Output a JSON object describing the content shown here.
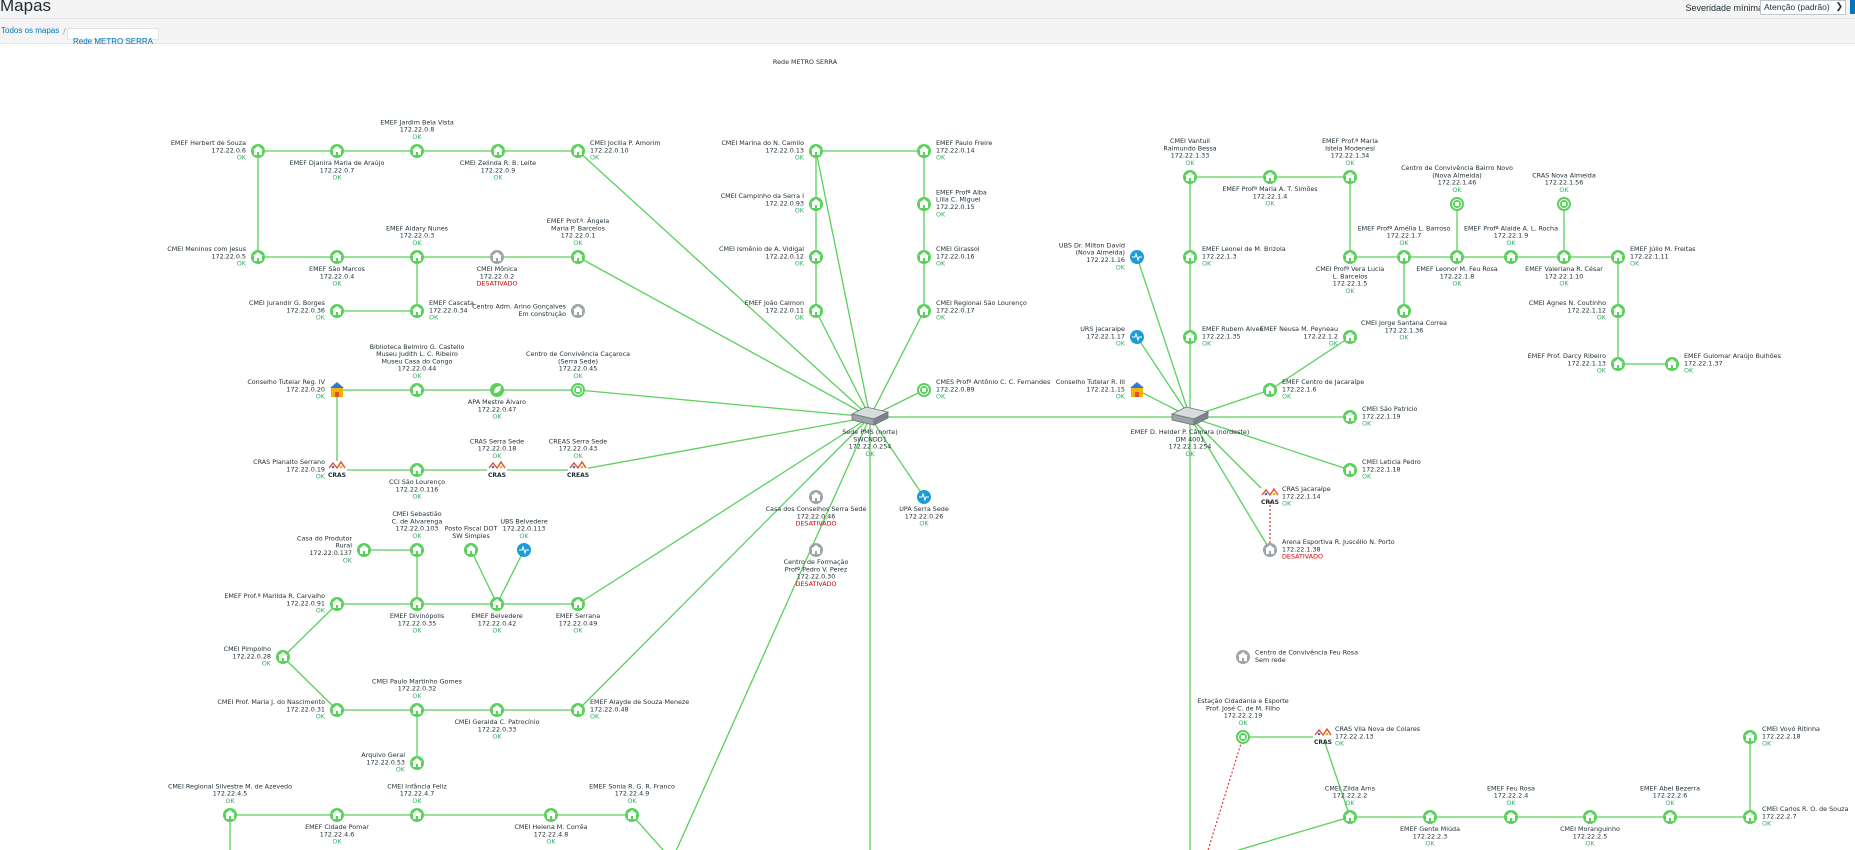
{
  "header": {
    "title": "Mapas",
    "severity_label": "Severidade mínima",
    "severity_value": "Atenção (padrão)"
  },
  "breadcrumbs": [
    {
      "label": "Todos os mapas"
    },
    {
      "label": "Rede METRO SERRA"
    }
  ],
  "map": {
    "title": "Rede METRO SERRA",
    "colors": {
      "link": "#59d15b",
      "link_red": "#e53935",
      "ok": "#34af67",
      "disabled": "#d40000",
      "blue_icon": "#1c9bd9",
      "gray_icon": "#9ea5a8"
    },
    "nodes": [
      {
        "id": "n1",
        "icon": "school",
        "lines": [
          "EMEF Herbert de Souza",
          "172.22.0.6"
        ],
        "status": "OK"
      },
      {
        "id": "n2",
        "icon": "school",
        "lines": [
          "EMEF Djanira Maria de Araújo",
          "172.22.0.7"
        ],
        "status": "OK"
      },
      {
        "id": "n3",
        "icon": "school",
        "lines": [
          "EMEF Jardim Bela Vista",
          "172.22.0.8"
        ],
        "status": "OK"
      },
      {
        "id": "n4",
        "icon": "school",
        "lines": [
          "CMEI Zelinda R. B. Leite",
          "172.22.0.9"
        ],
        "status": "OK"
      },
      {
        "id": "n5",
        "icon": "school",
        "lines": [
          "CMEI Jocilia P. Amorim",
          "172.22.0.10"
        ],
        "status": "OK"
      },
      {
        "id": "n6",
        "icon": "school",
        "lines": [
          "CMEI Meninos com Jesus",
          "172.22.0.5"
        ],
        "status": "OK"
      },
      {
        "id": "n7",
        "icon": "school",
        "lines": [
          "EMEF São Marcos",
          "172.22.0.4"
        ],
        "status": "OK"
      },
      {
        "id": "n8",
        "icon": "school",
        "lines": [
          "EMEF Aldary Nunes",
          "172.22.0.3"
        ],
        "status": "OK"
      },
      {
        "id": "n9",
        "icon": "school-gray",
        "lines": [
          "CMEI Mônica",
          "172.22.0.2"
        ],
        "status": "DESATIVADO"
      },
      {
        "id": "n10",
        "icon": "school",
        "lines": [
          "EMEF Prof.ª. Ângela",
          "Maria P. Barcelos",
          "172.22.0.1"
        ],
        "status": "OK"
      },
      {
        "id": "n11",
        "icon": "school",
        "lines": [
          "CMEI Jurandir G. Borges",
          "172.22.0.36"
        ],
        "status": "OK"
      },
      {
        "id": "n12",
        "icon": "school",
        "lines": [
          "EMEF Cascata",
          "172.22.0.34"
        ],
        "status": "OK"
      },
      {
        "id": "n13",
        "icon": "building-gray",
        "lines": [
          "Centro Adm. Arino Gonçalves",
          "Em construção"
        ],
        "status": ""
      },
      {
        "id": "n14",
        "icon": "conselho",
        "lines": [
          "Conselho Tutelar Reg. IV",
          "172.22.0.20"
        ],
        "status": "OK"
      },
      {
        "id": "n15",
        "icon": "school",
        "lines": [
          "Biblioteca Belmiro G. Castello",
          "Museu Judith L. C. Ribeiro",
          "Museu Casa do Congo",
          "172.22.0.44"
        ],
        "status": "OK"
      },
      {
        "id": "n16",
        "icon": "leaf",
        "lines": [
          "APA Mestre Álvaro",
          "172.22.0.47"
        ],
        "status": "OK"
      },
      {
        "id": "n17",
        "icon": "circle-building",
        "lines": [
          "Centro de Convivência Caçaroca",
          "(Serra Sede)",
          "172.22.0.45"
        ],
        "status": "OK"
      },
      {
        "id": "n18",
        "icon": "cras",
        "lines": [
          "CRAS Planalto Serrano",
          "172.22.0.19"
        ],
        "status": "OK"
      },
      {
        "id": "n19",
        "icon": "school",
        "lines": [
          "CCI São Lourenço",
          "172.22.0.116"
        ],
        "status": "OK"
      },
      {
        "id": "n20",
        "icon": "cras",
        "lines": [
          "CRAS Serra Sede",
          "172.22.0.18"
        ],
        "status": "OK"
      },
      {
        "id": "n21",
        "icon": "creas",
        "lines": [
          "CREAS Serra Sede",
          "172.22.0.43"
        ],
        "status": "OK"
      },
      {
        "id": "n22",
        "icon": "school",
        "lines": [
          "Casa do Produtor",
          "Rural",
          "172.22.0.137"
        ],
        "status": "OK"
      },
      {
        "id": "n23",
        "icon": "school",
        "lines": [
          "CMEI Sebastião",
          "C. de Alvarenga",
          "172.22.0.103"
        ],
        "status": "OK"
      },
      {
        "id": "n24",
        "icon": "school",
        "lines": [
          "Posto Fiscal DOT",
          "SW Simples"
        ],
        "status": ""
      },
      {
        "id": "n25",
        "icon": "health",
        "lines": [
          "UBS Belvedere",
          "172.22.0.113"
        ],
        "status": "OK"
      },
      {
        "id": "n26",
        "icon": "school",
        "lines": [
          "EMEF Prof.ª Marilda R. Carvalho",
          "172.22.0.91"
        ],
        "status": "OK"
      },
      {
        "id": "n27",
        "icon": "school",
        "lines": [
          "EMEF Divinópolis",
          "172.22.0.35"
        ],
        "status": "OK"
      },
      {
        "id": "n28",
        "icon": "school",
        "lines": [
          "EMEF Belvedere",
          "172.22.0.42"
        ],
        "status": "OK"
      },
      {
        "id": "n29",
        "icon": "school",
        "lines": [
          "EMEF Serrana",
          "172.22.0.49"
        ],
        "status": "OK"
      },
      {
        "id": "n30",
        "icon": "school",
        "lines": [
          "CMEI Pimpolho",
          "172.22.0.28"
        ],
        "status": "OK"
      },
      {
        "id": "n31",
        "icon": "school",
        "lines": [
          "CMEI Paulo Martinho Gomes",
          "172.22.0.32"
        ],
        "status": "OK"
      },
      {
        "id": "n32",
        "icon": "school",
        "lines": [
          "CMEI Prof. Maria J. do Nascimento",
          "172.22.0.31"
        ],
        "status": "OK"
      },
      {
        "id": "n33",
        "icon": "school",
        "lines": [
          "CMEI Geralda C. Patrocínio",
          "172.22.0.33"
        ],
        "status": "OK"
      },
      {
        "id": "n34",
        "icon": "school",
        "lines": [
          "EMEF Alayde de Souza Meneze",
          "172.22.0.48"
        ],
        "status": "OK"
      },
      {
        "id": "n35",
        "icon": "school",
        "lines": [
          "Arquivo Geral",
          "172.22.0.53"
        ],
        "status": "OK"
      },
      {
        "id": "n36",
        "icon": "school",
        "lines": [
          "CMEI Regional Silvestre M. de Azevedo",
          "172.22.4.5"
        ],
        "status": "OK"
      },
      {
        "id": "n37",
        "icon": "school",
        "lines": [
          "CMEI Infância Feliz",
          "172.22.4.7"
        ],
        "status": "OK"
      },
      {
        "id": "n38",
        "icon": "school",
        "lines": [
          "EMEF Sonia R. G. R. Franco",
          "172.22.4.9"
        ],
        "status": "OK"
      },
      {
        "id": "n39",
        "icon": "school",
        "lines": [
          "EMEF Cidade Pomar",
          "172.22.4.6"
        ],
        "status": "OK"
      },
      {
        "id": "n40",
        "icon": "school",
        "lines": [
          "CMEI Helena M. Corrêa",
          "172.22.4.8"
        ],
        "status": "OK"
      },
      {
        "id": "n41",
        "icon": "school",
        "lines": [
          "CMEI Marina do N. Camilo",
          "172.22.0.13"
        ],
        "status": "OK"
      },
      {
        "id": "n42",
        "icon": "school",
        "lines": [
          "EMEF Paulo Freire",
          "172.22.0.14"
        ],
        "status": "OK"
      },
      {
        "id": "n43",
        "icon": "school",
        "lines": [
          "CMEI Campinho da Serra I",
          "172.22.0.93"
        ],
        "status": "OK"
      },
      {
        "id": "n44",
        "icon": "school",
        "lines": [
          "EMEF Profª Alba",
          "Lilia C. Miguel",
          "172.22.0.15"
        ],
        "status": "OK"
      },
      {
        "id": "n45",
        "icon": "school",
        "lines": [
          "CMEI Ismênio de A. Vidigal",
          "172.22.0.12"
        ],
        "status": "OK"
      },
      {
        "id": "n46",
        "icon": "school",
        "lines": [
          "CMEI Girassol",
          "172.22.0.16"
        ],
        "status": "OK"
      },
      {
        "id": "n47",
        "icon": "school",
        "lines": [
          "EMEF João Calmon",
          "172.22.0.11"
        ],
        "status": "OK"
      },
      {
        "id": "n48",
        "icon": "school",
        "lines": [
          "CMEI Regional São Lourenço",
          "172.22.0.17"
        ],
        "status": "OK"
      },
      {
        "id": "n49",
        "icon": "circle-building",
        "lines": [
          "CMES Profº Antônio C. C. Fernandes",
          "172.22.0.89"
        ],
        "status": "OK"
      },
      {
        "id": "n50",
        "icon": "switch",
        "lines": [
          "Sede PMS (norte)",
          "SWCNDD1",
          "172.22.0.254"
        ],
        "status": "OK"
      },
      {
        "id": "n51",
        "icon": "building-gray",
        "lines": [
          "Casa dos Conselhos Serra Sede",
          "172.22.0.46"
        ],
        "status": "DESATIVADO"
      },
      {
        "id": "n52",
        "icon": "health",
        "lines": [
          "UPA Serra Sede",
          "172.22.0.26"
        ],
        "status": "OK"
      },
      {
        "id": "n53",
        "icon": "building-gray",
        "lines": [
          "Centro de Formação",
          "Profª Pedro V. Perez",
          "172.22.0.30"
        ],
        "status": "DESATIVADO"
      },
      {
        "id": "n54",
        "icon": "school",
        "lines": [
          "CMEI Vantuil",
          "Raimundo Bessa",
          "172.22.1.33"
        ],
        "status": "OK"
      },
      {
        "id": "n55",
        "icon": "school",
        "lines": [
          "EMEF Profª Maria A. T. Simões",
          "172.22.1.4"
        ],
        "status": "OK"
      },
      {
        "id": "n56",
        "icon": "school",
        "lines": [
          "EMEF Prof.ª Maria",
          "Istela Modenesi",
          "172.22.1.34"
        ],
        "status": "OK"
      },
      {
        "id": "n57",
        "icon": "circle-building",
        "lines": [
          "Centro de Convivência Bairro Novo",
          "(Nova Almeida)",
          "172.22.1.46"
        ],
        "status": "OK"
      },
      {
        "id": "n58",
        "icon": "circle-building",
        "lines": [
          "CRAS Nova Almeida",
          "172.22.1.56"
        ],
        "status": "OK"
      },
      {
        "id": "n59",
        "icon": "health",
        "lines": [
          "UBS Dr. Milton David",
          "(Nova Almeida)",
          "172.22.1.16"
        ],
        "status": "OK"
      },
      {
        "id": "n60",
        "icon": "school",
        "lines": [
          "EMEF Leonel de M. Brizola",
          "172.22.1.3"
        ],
        "status": "OK"
      },
      {
        "id": "n61",
        "icon": "school",
        "lines": [
          "EMEF Profª Amélia L. Barroso",
          "172.22.1.7"
        ],
        "status": "OK"
      },
      {
        "id": "n62",
        "icon": "school",
        "lines": [
          "EMEF Profª Alaide A. L. Rocha",
          "172.22.1.9"
        ],
        "status": "OK"
      },
      {
        "id": "n63",
        "icon": "school",
        "lines": [
          "EMEF Júlio M. Freitas",
          "172.22.1.11"
        ],
        "status": "OK"
      },
      {
        "id": "n64",
        "icon": "school",
        "lines": [
          "CMEI Profª Vera Lucia",
          "L. Barcelos",
          "172.22.1.5"
        ],
        "status": "OK"
      },
      {
        "id": "n65",
        "icon": "school",
        "lines": [
          "EMEF Leonor M. Feu Rosa",
          "172.22.1.8"
        ],
        "status": "OK"
      },
      {
        "id": "n66",
        "icon": "school",
        "lines": [
          "EMEF Valeriana R. César",
          "172.22.1.10"
        ],
        "status": "OK"
      },
      {
        "id": "n67",
        "icon": "school",
        "lines": [
          "CMEI Agnes N. Coutinho",
          "172.22.1.12"
        ],
        "status": "OK"
      },
      {
        "id": "n68",
        "icon": "health",
        "lines": [
          "URS Jacaraipe",
          "172.22.1.17"
        ],
        "status": "OK"
      },
      {
        "id": "n69",
        "icon": "school",
        "lines": [
          "EMEF Rubem Alves",
          "172.22.1.35"
        ],
        "status": "OK"
      },
      {
        "id": "n70",
        "icon": "school",
        "lines": [
          "CMEI Jorge Santana Correa",
          "172.22.1.36"
        ],
        "status": "OK"
      },
      {
        "id": "n71",
        "icon": "school",
        "lines": [
          "EMEF Neusa M. Peyneau",
          "172.22.1.2"
        ],
        "status": "OK"
      },
      {
        "id": "n72",
        "icon": "school",
        "lines": [
          "EMEF Prof. Darcy Ribeiro",
          "172.22.1.13"
        ],
        "status": "OK"
      },
      {
        "id": "n73",
        "icon": "school",
        "lines": [
          "EMEF Gulomar Araújo Bulhões",
          "172.22.1.37"
        ],
        "status": "OK"
      },
      {
        "id": "n74",
        "icon": "conselho",
        "lines": [
          "Conselho Tutelar R. III",
          "172.22.1.15"
        ],
        "status": "OK"
      },
      {
        "id": "n75",
        "icon": "school",
        "lines": [
          "EMEF Centro de Jacaraípe",
          "172.22.1.6"
        ],
        "status": "OK"
      },
      {
        "id": "n76",
        "icon": "switch",
        "lines": [
          "EMEF D. Helder P. Câmara (nordeste)",
          "DM 4001",
          "172.22.1.254"
        ],
        "status": "OK"
      },
      {
        "id": "n77",
        "icon": "school",
        "lines": [
          "CMEI São Patrício",
          "172.22.1.19"
        ],
        "status": "OK"
      },
      {
        "id": "n78",
        "icon": "school",
        "lines": [
          "CMEI Leticia Pedro",
          "172.22.1.18"
        ],
        "status": "OK"
      },
      {
        "id": "n79",
        "icon": "cras",
        "lines": [
          "CRAS Jacaraípe",
          "172.22.1.14"
        ],
        "status": "OK"
      },
      {
        "id": "n80",
        "icon": "building-gray",
        "lines": [
          "Arena Esportiva R. Juscélio N. Porto",
          "172.22.1.38"
        ],
        "status": "DESATIVADO"
      },
      {
        "id": "n81",
        "icon": "building-gray",
        "lines": [
          "Centro de Convivência Feu Rosa",
          "Sem rede"
        ],
        "status": ""
      },
      {
        "id": "n82",
        "icon": "circle-building",
        "lines": [
          "Estação Cidadania e Esporte",
          "Prof. José C. de M. Filho",
          "172.22.2.19"
        ],
        "status": "OK"
      },
      {
        "id": "n83",
        "icon": "cras",
        "lines": [
          "CRAS Vila Nova de Colares",
          "172.22.2.13"
        ],
        "status": "OK"
      },
      {
        "id": "n84",
        "icon": "school",
        "lines": [
          "CMEI Vovó Ritinha",
          "172.22.2.18"
        ],
        "status": "OK"
      },
      {
        "id": "n85",
        "icon": "school",
        "lines": [
          "CMEI Zilda Arns",
          "172.22.2.2"
        ],
        "status": "OK"
      },
      {
        "id": "n86",
        "icon": "school",
        "lines": [
          "EMEF Feu Rosa",
          "172.22.2.4"
        ],
        "status": "OK"
      },
      {
        "id": "n87",
        "icon": "school",
        "lines": [
          "EMEF Abel Bezerra",
          "172.22.2.6"
        ],
        "status": "OK"
      },
      {
        "id": "n88",
        "icon": "school",
        "lines": [
          "CMEI Carlos R. O. de Souza",
          "172.22.2.7"
        ],
        "status": "OK"
      },
      {
        "id": "n89",
        "icon": "school",
        "lines": [
          "EMEF Gente Miúda",
          "172.22.2.3"
        ],
        "status": "OK"
      },
      {
        "id": "n90",
        "icon": "school",
        "lines": [
          "CMEI Moranguinho",
          "172.22.2.5"
        ],
        "status": "OK"
      }
    ]
  }
}
